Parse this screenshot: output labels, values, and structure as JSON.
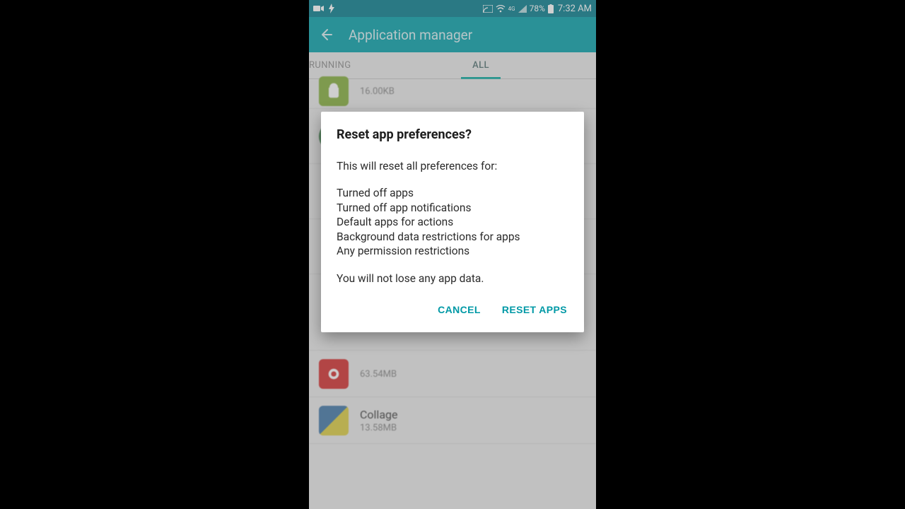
{
  "status": {
    "battery_pct": "78%",
    "time": "7:32 AM",
    "carrier_indicator": "4G"
  },
  "appbar": {
    "title": "Application manager"
  },
  "tabs": {
    "running": "RUNNING",
    "all": "ALL"
  },
  "apps": [
    {
      "name": "",
      "size": "16.00KB"
    },
    {
      "name": "",
      "size": "63.54MB"
    },
    {
      "name": "Collage",
      "size": "13.58MB"
    }
  ],
  "dialog": {
    "title": "Reset app preferences?",
    "intro": "This will reset all preferences for:",
    "items": [
      "Turned off apps",
      "Turned off app notifications",
      "Default apps for actions",
      "Background data restrictions for apps",
      "Any permission restrictions"
    ],
    "footer": "You will not lose any app data.",
    "cancel": "CANCEL",
    "confirm": "RESET APPS"
  }
}
